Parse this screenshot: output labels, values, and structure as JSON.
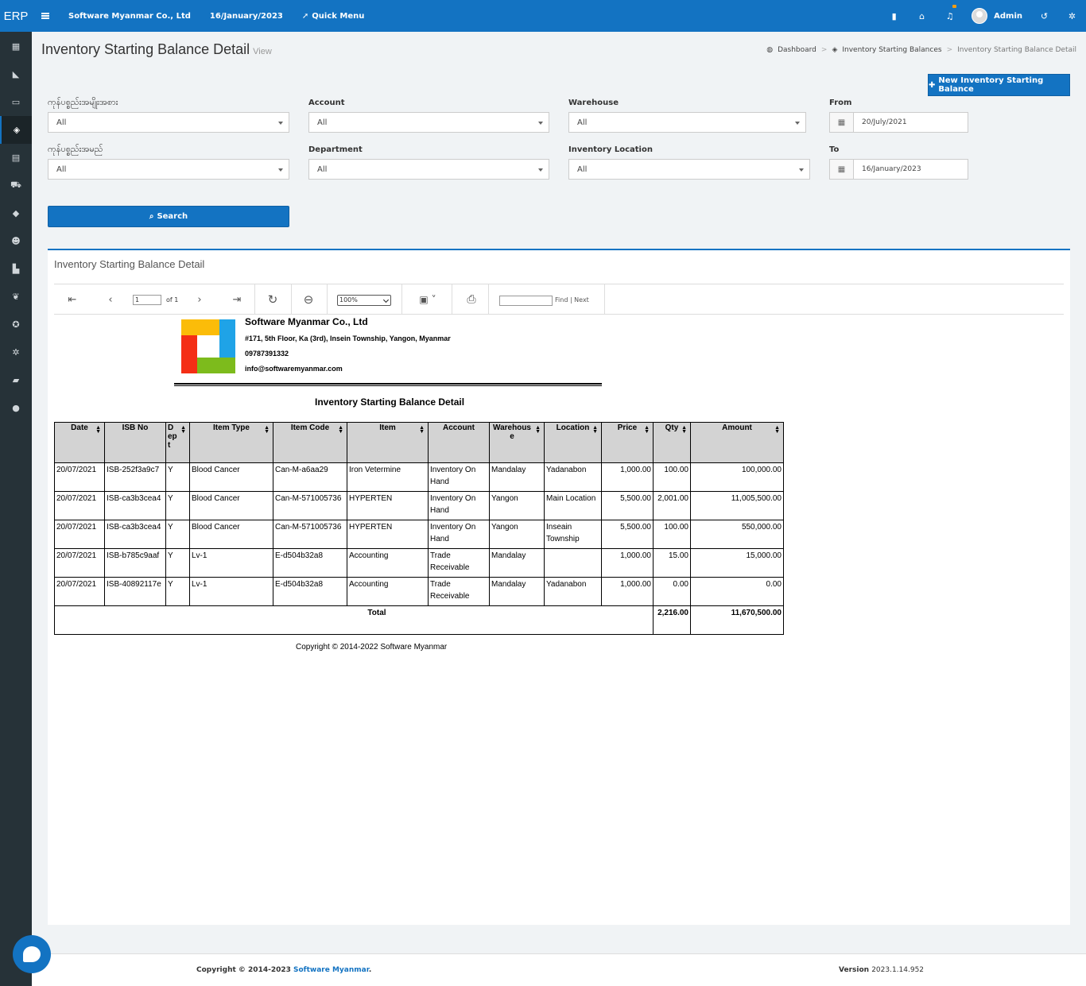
{
  "app": {
    "brand": "ERP",
    "company": "Software Myanmar Co., Ltd",
    "date": "16/January/2023",
    "quick_menu": "Quick Menu",
    "user": "Admin"
  },
  "sidebar": {
    "items": [
      {
        "icon": "calculator-icon",
        "glyph": "▦"
      },
      {
        "icon": "chart-area-icon",
        "glyph": "◣"
      },
      {
        "icon": "credit-card-icon",
        "glyph": "▭"
      },
      {
        "icon": "cube-icon",
        "glyph": "◈"
      },
      {
        "icon": "clipboard-icon",
        "glyph": "▤"
      },
      {
        "icon": "cart-icon",
        "glyph": "⛟"
      },
      {
        "icon": "diamond-icon",
        "glyph": "◆"
      },
      {
        "icon": "users-icon",
        "glyph": "☻"
      },
      {
        "icon": "bar-chart-icon",
        "glyph": "▙"
      },
      {
        "icon": "leaf-icon",
        "glyph": "❦"
      },
      {
        "icon": "soccer-icon",
        "glyph": "✪"
      },
      {
        "icon": "cog-icon",
        "glyph": "✲"
      },
      {
        "icon": "book-icon",
        "glyph": "▰"
      },
      {
        "icon": "comment-icon",
        "glyph": "●"
      }
    ]
  },
  "header": {
    "title": "Inventory Starting Balance Detail",
    "subtitle": "View",
    "breadcrumb": [
      "Dashboard",
      "Inventory Starting Balances",
      "Inventory Starting Balance Detail"
    ],
    "new_button": "New Inventory Starting Balance"
  },
  "filters": {
    "item_type_label": "ကုန်ပစ္စည်းအမျိုးအစား",
    "item_type_value": "All",
    "item_label": "ကုန်ပစ္စည်းအမည်",
    "item_value": "All",
    "account_label": "Account",
    "account_value": "All",
    "department_label": "Department",
    "department_value": "All",
    "warehouse_label": "Warehouse",
    "warehouse_value": "All",
    "location_label": "Inventory Location",
    "location_value": "All",
    "from_label": "From",
    "from_value": "20/July/2021",
    "to_label": "To",
    "to_value": "16/January/2023",
    "search_button": "Search"
  },
  "report_panel": {
    "title": "Inventory Starting Balance Detail",
    "toolbar": {
      "page": "1",
      "of_pages": "of 1",
      "zoom": "100%",
      "find": "Find",
      "next": "| Next"
    }
  },
  "report": {
    "company": "Software Myanmar Co., Ltd",
    "address": "#171, 5th Floor, Ka (3rd), Insein Township, Yangon, Myanmar",
    "phone": "09787391332",
    "email": "info@softwaremyanmar.com",
    "title": "Inventory Starting Balance Detail",
    "columns": [
      "Date",
      "ISB No",
      "D ep t",
      "Item Type",
      "Item Code",
      "Item",
      "Account",
      "Warehous e",
      "Location",
      "Price",
      "Qty",
      "Amount"
    ],
    "rows": [
      [
        "20/07/2021",
        "ISB-252f3a9c7",
        "Y",
        "Blood Cancer",
        "Can-M-a6aa29",
        "Iron Vetermine",
        "Inventory On Hand",
        "Mandalay",
        "Yadanabon",
        "1,000.00",
        "100.00",
        "100,000.00"
      ],
      [
        "20/07/2021",
        "ISB-ca3b3cea4",
        "Y",
        "Blood Cancer",
        "Can-M-571005736",
        "HYPERTEN",
        "Inventory On Hand",
        "Yangon",
        "Main Location",
        "5,500.00",
        "2,001.00",
        "11,005,500.00"
      ],
      [
        "20/07/2021",
        "ISB-ca3b3cea4",
        "Y",
        "Blood Cancer",
        "Can-M-571005736",
        "HYPERTEN",
        "Inventory On Hand",
        "Yangon",
        "Inseain Township",
        "5,500.00",
        "100.00",
        "550,000.00"
      ],
      [
        "20/07/2021",
        "ISB-b785c9aaf",
        "Y",
        "Lv-1",
        "E-d504b32a8",
        "Accounting",
        "Trade Receivable",
        "Mandalay",
        "",
        "1,000.00",
        "15.00",
        "15,000.00"
      ],
      [
        "20/07/2021",
        "ISB-40892117e",
        "Y",
        "Lv-1",
        "E-d504b32a8",
        "Accounting",
        "Trade Receivable",
        "Mandalay",
        "Yadanabon",
        "1,000.00",
        "0.00",
        "0.00"
      ]
    ],
    "total_label": "Total",
    "total_qty": "2,216.00",
    "total_amount": "11,670,500.00",
    "copyright": "Copyright © 2014-2022 Software Myanmar"
  },
  "footer": {
    "copyright_prefix": "Copyright © 2014-2023 ",
    "copyright_link": "Software Myanmar",
    "copyright_suffix": ".",
    "version_label": "Version ",
    "version": "2023.1.14.952"
  },
  "colors": {
    "primary": "#1373c2",
    "sidebar": "#263238",
    "header_cell": "#d3d3d3"
  }
}
